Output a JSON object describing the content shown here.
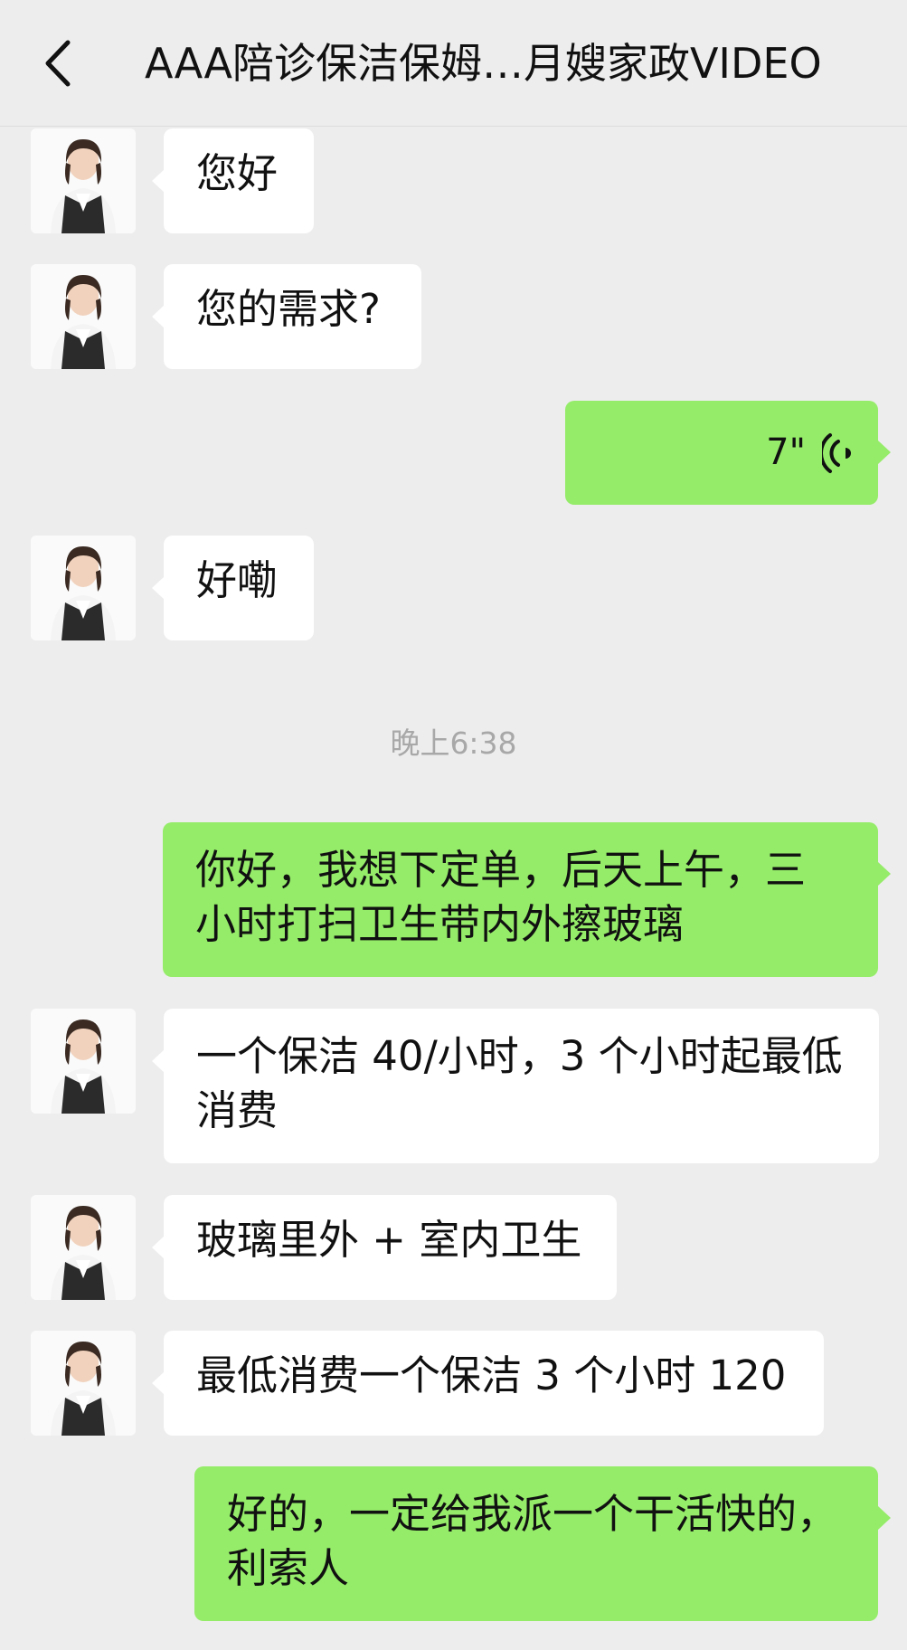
{
  "header": {
    "title": "AAA陪诊保洁保姆…月嫂家政VIDEO"
  },
  "time_label": "晚上6:38",
  "messages": [
    {
      "side": "in",
      "text": "您好"
    },
    {
      "side": "in",
      "text": "您的需求?"
    },
    {
      "side": "out",
      "type": "voice",
      "duration": "7\""
    },
    {
      "side": "in",
      "text": "好嘞"
    },
    {
      "side": "out",
      "text_line1": "你好，我想下定单，后天上午，三",
      "text_line2": "小时打扫卫生带内外擦玻璃"
    },
    {
      "side": "in",
      "text_line1": "一个保洁 40/小时，3 个小时起最低",
      "text_line2": "消费"
    },
    {
      "side": "in",
      "text": "玻璃里外 + 室内卫生"
    },
    {
      "side": "in",
      "text": "最低消费一个保洁 3 个小时 120"
    },
    {
      "side": "out",
      "text_line1": "好的，一定给我派一个干活快的，",
      "text_line2": "利索人"
    }
  ],
  "colors": {
    "background": "#ededed",
    "incoming_bubble": "#ffffff",
    "outgoing_bubble": "#95ec69"
  },
  "icons": {
    "back": "chevron-left-icon",
    "voice": "voice-wave-icon",
    "avatar": "avatar-woman"
  }
}
